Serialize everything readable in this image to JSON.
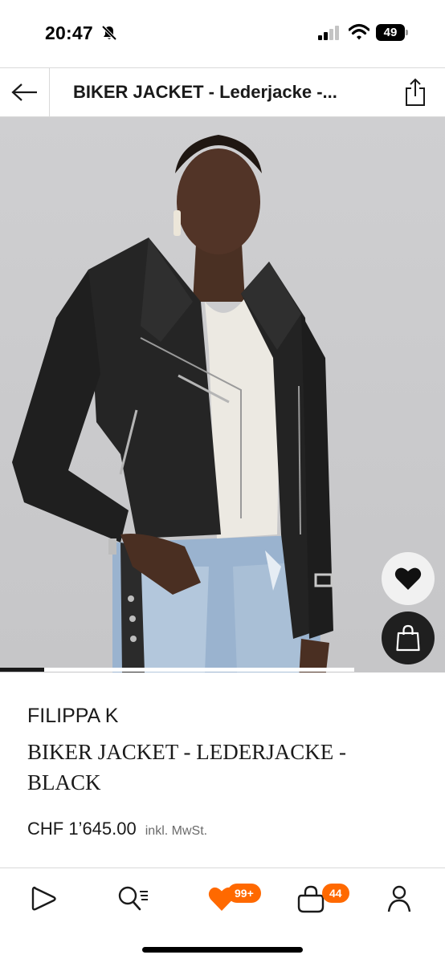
{
  "status_bar": {
    "time": "20:47",
    "battery": "49",
    "icons": [
      "bell-slash-icon",
      "signal-icon",
      "wifi-icon",
      "battery-icon"
    ]
  },
  "header": {
    "title": "BIKER JACKET - Lederjacke -...",
    "back_icon": "arrow-left-icon",
    "share_icon": "share-icon"
  },
  "gallery": {
    "progress": 0.125,
    "wishlist_icon": "heart-icon",
    "bag_icon": "shopping-bag-icon"
  },
  "product": {
    "brand": "FILIPPA K",
    "name": "BIKER JACKET - LEDERJACKE - BLACK",
    "price": "CHF 1’645.00",
    "tax_note": "inkl. MwSt."
  },
  "bottom_nav": {
    "items": [
      {
        "name": "home",
        "icon": "play-outline-icon"
      },
      {
        "name": "search",
        "icon": "search-filter-icon"
      },
      {
        "name": "wishlist",
        "icon": "heart-icon",
        "badge": "99+"
      },
      {
        "name": "bag",
        "icon": "bag-icon",
        "badge": "44"
      },
      {
        "name": "account",
        "icon": "person-icon"
      }
    ]
  },
  "colors": {
    "accent": "#ff6900",
    "text": "#1a1a1a",
    "divider": "#d9d9d9"
  }
}
